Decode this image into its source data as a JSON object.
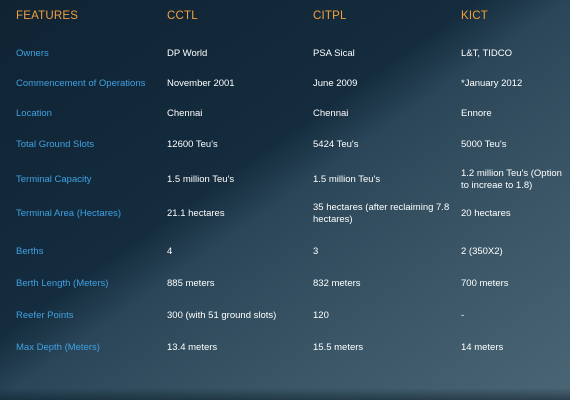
{
  "table": {
    "headers": [
      "FEATURES",
      "CCTL",
      "CITPL",
      "KICT"
    ],
    "rows": [
      [
        "Owners",
        "DP World",
        "PSA Sical",
        "L&T, TIDCO"
      ],
      [
        "Commencement of Operations",
        "November 2001",
        "June 2009",
        "*January 2012"
      ],
      [
        "Location",
        "Chennai",
        "Chennai",
        "Ennore"
      ],
      [
        "Total Ground Slots",
        "12600 Teu's",
        "5424 Teu's",
        "5000 Teu's"
      ],
      [
        "Terminal Capacity",
        "1.5 million Teu's",
        "1.5 million Teu's",
        "1.2 million Teu's (Option to increae to 1.8)"
      ],
      [
        "Terminal Area (Hectares)",
        "21.1 hectares",
        "35 hectares (after reclaiming 7.8 hectares)",
        "20 hectares"
      ],
      [
        "Berths",
        "4",
        "3",
        "2 (350X2)"
      ],
      [
        "Berth Length (Meters)",
        "885 meters",
        "832 meters",
        "700 meters"
      ],
      [
        "Reefer Points",
        "300  (with 51 ground slots)",
        "120",
        "-"
      ],
      [
        "Max Depth (Meters)",
        "13.4 meters",
        "15.5 meters",
        "14 meters"
      ]
    ]
  },
  "colors": {
    "header_text": "#f2a03d",
    "feature_label": "#3fa2e3",
    "value_text": "#ffffff",
    "background_dark": "#0f2333",
    "background_light": "#4a6575"
  }
}
